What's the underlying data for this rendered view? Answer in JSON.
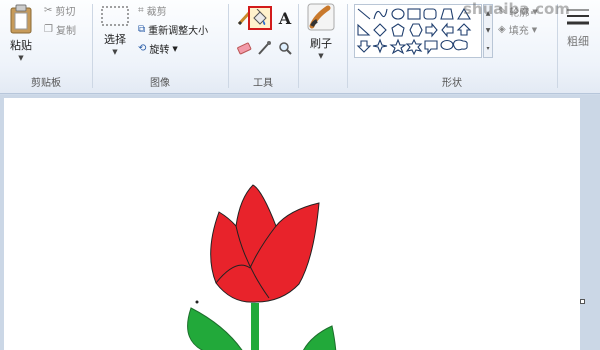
{
  "clipboard": {
    "paste_label": "粘贴",
    "cut_label": "剪切",
    "copy_label": "复制",
    "group_label": "剪贴板"
  },
  "image": {
    "select_label": "选择",
    "crop_label": "裁剪",
    "resize_label": "重新调整大小",
    "rotate_label": "旋转",
    "group_label": "图像"
  },
  "tools": {
    "group_label": "工具",
    "text_glyph": "A",
    "selected_tool": "fill-with-color"
  },
  "brushes": {
    "label": "刷子"
  },
  "shapes": {
    "group_label": "形状",
    "outline_label": "轮廓",
    "fill_label": "填充"
  },
  "size": {
    "label": "粗细"
  },
  "watermark": {
    "text": "shuaiba.com"
  },
  "colors": {
    "selection_highlight": "#d21b1b",
    "tulip_red": "#e8232b",
    "leaf_green": "#22a93a"
  }
}
